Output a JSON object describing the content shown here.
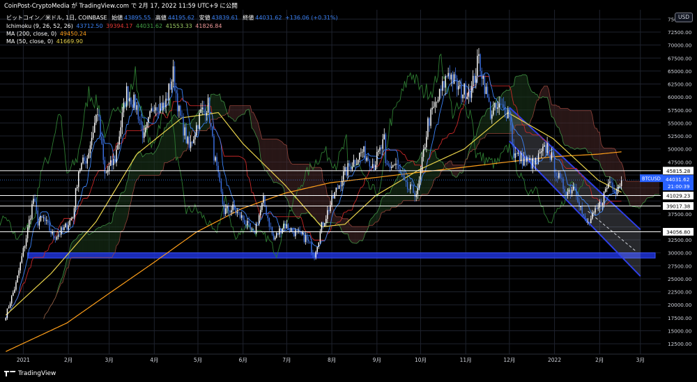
{
  "header": {
    "brand": "CoinPost-CryptoMedia が TradingView.com で 2月 17, 2022 11:59 UTC+9 に公開",
    "symbol_line": {
      "symbol": "ビットコイン／米ドル, 1日, COINBASE",
      "open_label": "始値",
      "open": "43895.55",
      "high_label": "高値",
      "high": "44195.62",
      "low_label": "安値",
      "low": "43839.61",
      "close_label": "終値",
      "close": "44031.62",
      "change": "+136.06 (+0.31%)"
    },
    "ichimoku": {
      "label": "Ichimoku (9, 26, 52, 26)",
      "v1": "43712.50",
      "v2": "39394.17",
      "v3": "44031.62",
      "v4": "41553.33",
      "v5": "41826.84"
    },
    "ma200": {
      "label": "MA (200, close, 0)",
      "value": "49450.24"
    },
    "ma50": {
      "label": "MA (50, close, 0)",
      "value": "41669.90"
    }
  },
  "currency_button": "USD",
  "footer": {
    "logo_text": "TradingView"
  },
  "colors": {
    "background": "#000000",
    "grid": "#1e222d",
    "up_candle": "#ffffff",
    "down_candle": "#3b6fe0",
    "channel": "#2e3fe8",
    "support_zone": "#1f33d6",
    "ma200": "#ff9f1a",
    "ma50": "#e8d24a",
    "tenkan": "#3b82f6",
    "kijun": "#c62828",
    "chikou": "#2e7d32",
    "cloud_bull": "#1e3a1e",
    "cloud_bear": "#4a2a2a"
  },
  "chart_data": {
    "type": "candlestick",
    "x_axis": {
      "ticks": [
        "2021",
        "2月",
        "3月",
        "4月",
        "5月",
        "6月",
        "7月",
        "8月",
        "9月",
        "10月",
        "11月",
        "12月",
        "2022",
        "2月",
        "3月"
      ]
    },
    "y_axis": {
      "scale": "linear",
      "ylim": [
        10500,
        76800
      ],
      "ticks": [
        "12500.00",
        "15000.00",
        "17500.00",
        "20000.00",
        "22500.00",
        "25000.00",
        "27500.00",
        "30000.00",
        "32500.00",
        "35000.00",
        "37500.00",
        "40000.00",
        "42500.00",
        "45000.00",
        "47500.00",
        "50000.00",
        "52500.00",
        "55000.00",
        "57500.00",
        "60000.00",
        "62500.00",
        "65000.00",
        "67500.00",
        "70000.00",
        "72500.00",
        "75000.00"
      ]
    },
    "horizontal_levels": [
      {
        "value": 45815.28,
        "label": "45815.28"
      },
      {
        "value": 41029.23,
        "label": "41029.23"
      },
      {
        "value": 39017.38,
        "label": "39017.38"
      },
      {
        "value": 34056.8,
        "label": "34056.80"
      }
    ],
    "last_price": {
      "label": "BTCUSD",
      "value": "44031.62",
      "countdown": "21:00:39"
    },
    "support_zone": {
      "from": 29000,
      "to": 30000
    },
    "descending_channel": {
      "upper": [
        [
          "2021-12-01",
          58000
        ],
        [
          "2022-03-01",
          34500
        ]
      ],
      "lower": [
        [
          "2021-12-01",
          51500
        ],
        [
          "2022-03-01",
          25500
        ]
      ]
    },
    "close_path": [
      [
        "2020-12-20",
        18000
      ],
      [
        "2020-12-27",
        24000
      ],
      [
        "2021-01-03",
        33000
      ],
      [
        "2021-01-08",
        40500
      ],
      [
        "2021-01-11",
        36000
      ],
      [
        "2021-01-15",
        36500
      ],
      [
        "2021-01-22",
        33000
      ],
      [
        "2021-01-29",
        34500
      ],
      [
        "2021-02-04",
        37000
      ],
      [
        "2021-02-08",
        46000
      ],
      [
        "2021-02-14",
        48500
      ],
      [
        "2021-02-21",
        57500
      ],
      [
        "2021-02-26",
        45000
      ],
      [
        "2021-03-05",
        48000
      ],
      [
        "2021-03-13",
        61000
      ],
      [
        "2021-03-20",
        58000
      ],
      [
        "2021-03-25",
        52000
      ],
      [
        "2021-04-01",
        59000
      ],
      [
        "2021-04-08",
        58000
      ],
      [
        "2021-04-14",
        64500
      ],
      [
        "2021-04-18",
        57000
      ],
      [
        "2021-04-25",
        50000
      ],
      [
        "2021-05-03",
        57000
      ],
      [
        "2021-05-08",
        58500
      ],
      [
        "2021-05-12",
        49000
      ],
      [
        "2021-05-19",
        38000
      ],
      [
        "2021-05-25",
        38500
      ],
      [
        "2021-06-01",
        36500
      ],
      [
        "2021-06-08",
        33500
      ],
      [
        "2021-06-15",
        40000
      ],
      [
        "2021-06-22",
        32500
      ],
      [
        "2021-06-29",
        35500
      ],
      [
        "2021-07-06",
        34000
      ],
      [
        "2021-07-14",
        32800
      ],
      [
        "2021-07-20",
        29800
      ],
      [
        "2021-07-25",
        35000
      ],
      [
        "2021-08-01",
        40000
      ],
      [
        "2021-08-08",
        44500
      ],
      [
        "2021-08-14",
        47000
      ],
      [
        "2021-08-22",
        49500
      ],
      [
        "2021-08-30",
        47000
      ],
      [
        "2021-09-06",
        51500
      ],
      [
        "2021-09-07",
        46500
      ],
      [
        "2021-09-14",
        47000
      ],
      [
        "2021-09-21",
        42500
      ],
      [
        "2021-09-29",
        41500
      ],
      [
        "2021-10-06",
        55000
      ],
      [
        "2021-10-15",
        61000
      ],
      [
        "2021-10-20",
        65000
      ],
      [
        "2021-10-28",
        61000
      ],
      [
        "2021-11-05",
        61500
      ],
      [
        "2021-11-10",
        67500
      ],
      [
        "2021-11-18",
        57000
      ],
      [
        "2021-11-25",
        58000
      ],
      [
        "2021-12-01",
        57000
      ],
      [
        "2021-12-04",
        49000
      ],
      [
        "2021-12-10",
        48000
      ],
      [
        "2021-12-18",
        47000
      ],
      [
        "2021-12-27",
        50500
      ],
      [
        "2022-01-05",
        43500
      ],
      [
        "2022-01-10",
        41800
      ],
      [
        "2022-01-15",
        43000
      ],
      [
        "2022-01-21",
        36500
      ],
      [
        "2022-01-24",
        35500
      ],
      [
        "2022-01-31",
        38500
      ],
      [
        "2022-02-08",
        44000
      ],
      [
        "2022-02-12",
        42200
      ],
      [
        "2022-02-16",
        44031.62
      ]
    ],
    "ma200_path": [
      [
        "2020-12-20",
        11000
      ],
      [
        "2021-01-31",
        16500
      ],
      [
        "2021-02-28",
        22000
      ],
      [
        "2021-03-31",
        28000
      ],
      [
        "2021-04-30",
        34000
      ],
      [
        "2021-05-31",
        38500
      ],
      [
        "2021-06-30",
        41500
      ],
      [
        "2021-07-31",
        43500
      ],
      [
        "2021-08-31",
        44500
      ],
      [
        "2021-09-30",
        45500
      ],
      [
        "2021-10-31",
        46500
      ],
      [
        "2021-11-30",
        47500
      ],
      [
        "2021-12-31",
        48500
      ],
      [
        "2022-01-31",
        49000
      ],
      [
        "2022-02-16",
        49450.24
      ]
    ],
    "ma50_path": [
      [
        "2020-12-20",
        18000
      ],
      [
        "2021-01-20",
        26000
      ],
      [
        "2021-02-20",
        36000
      ],
      [
        "2021-03-20",
        49000
      ],
      [
        "2021-04-20",
        56000
      ],
      [
        "2021-05-15",
        57000
      ],
      [
        "2021-06-01",
        51000
      ],
      [
        "2021-06-30",
        43000
      ],
      [
        "2021-07-25",
        35000
      ],
      [
        "2021-08-10",
        35500
      ],
      [
        "2021-08-31",
        41000
      ],
      [
        "2021-09-30",
        46000
      ],
      [
        "2021-10-31",
        50000
      ],
      [
        "2021-11-30",
        57000
      ],
      [
        "2021-12-31",
        52000
      ],
      [
        "2022-01-31",
        44000
      ],
      [
        "2022-02-16",
        41669.9
      ]
    ]
  }
}
